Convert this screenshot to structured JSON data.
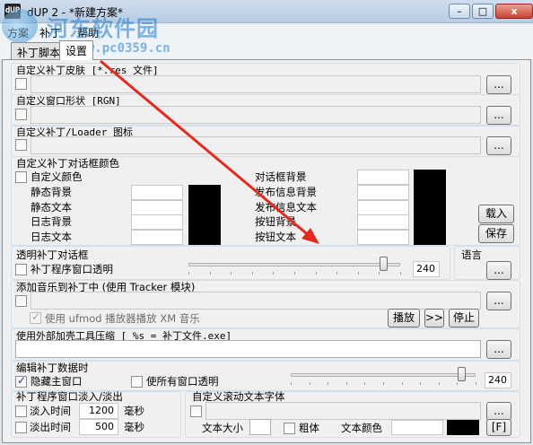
{
  "window": {
    "title": "dUP 2 - *新建方案*",
    "icon_text": "dUP",
    "min": "–",
    "max": "□",
    "close": "x"
  },
  "watermark": {
    "title": "河东软件园",
    "url": "www.pc0359.cn"
  },
  "menu": [
    "方案",
    "补丁",
    "帮助"
  ],
  "tabs": [
    "补丁脚本",
    "设置"
  ],
  "skin": {
    "label": "自定义补丁皮肤 [*.res 文件]",
    "browse": "..."
  },
  "shape": {
    "label": "自定义窗口形状 [RGN]",
    "browse": "..."
  },
  "loader_icon": {
    "label": "自定义补丁/Loader 图标",
    "browse": "..."
  },
  "dialog_colors": {
    "label": "自定义补丁对话框颜色",
    "custom_colors": "自定义颜色",
    "left_rows": [
      "静态背景",
      "静态文本",
      "日志背景",
      "日志文本"
    ],
    "right_rows": [
      "对话框背景",
      "发布信息背景",
      "发布信息文本",
      "按钮背景",
      "按钮文本"
    ],
    "load": "载入",
    "save": "保存"
  },
  "transparent": {
    "label": "透明补丁对话框",
    "checkbox": "补丁程序窗口透明",
    "value": "240",
    "value_fraction": 0.92
  },
  "language": {
    "label": "语言",
    "browse": "..."
  },
  "music": {
    "label": "添加音乐到补丁中 (使用 Tracker 模块)",
    "browse": "...",
    "ufmod": "使用 ufmod 播放器播放 XM 音乐",
    "play": "播放",
    "next": ">>",
    "stop": "停止"
  },
  "packer": {
    "label": "使用外部加壳工具压缩 [ %s = 补丁文件.exe]",
    "browse": "..."
  },
  "edit_data": {
    "label": "编辑补丁数据时",
    "hide_main": "隐藏主窗口",
    "all_transparent": "使所有窗口透明",
    "value": "240",
    "value_fraction": 0.92
  },
  "fade": {
    "label": "补丁程序窗口淡入/淡出",
    "fade_in": "淡入时间",
    "fade_in_value": "1200",
    "fade_out": "淡出时间",
    "fade_out_value": "500",
    "unit": "毫秒"
  },
  "scroll_font": {
    "label": "自定义滚动文本字体",
    "size_label": "文本大小",
    "bold": "粗体",
    "color_label": "文本颜色",
    "font_btn": "[F]"
  },
  "colors": {
    "accent_watermark": "#1f7ed0",
    "swatch_dark": "#000000",
    "swatch_light": "#ffffff"
  }
}
